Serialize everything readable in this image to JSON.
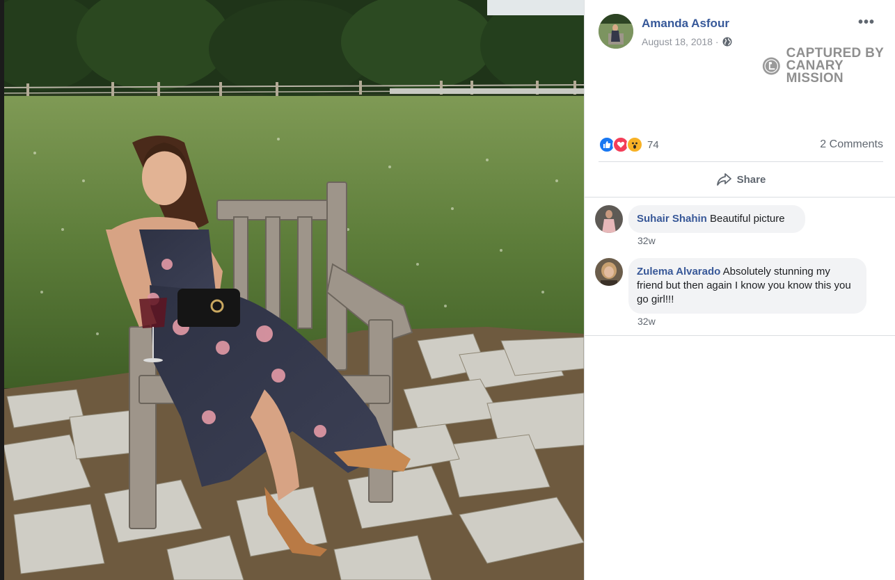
{
  "post": {
    "author": "Amanda Asfour",
    "date": "August 18, 2018 ·",
    "privacy_icon": "globe-icon",
    "more_icon": "ellipsis-icon",
    "watermark_line1": "CAPTURED BY",
    "watermark_line2": "CANARY MISSION",
    "reaction_count": "74",
    "reactions": [
      "like",
      "love",
      "wow"
    ],
    "comments_count": "2 Comments",
    "share_label": "Share"
  },
  "comments": [
    {
      "author": "Suhair Shahin",
      "text": " Beautiful picture",
      "time": "32w"
    },
    {
      "author": "Zulema Alvarado",
      "text": " Absolutely stunning my friend but then again I know you know this you go girl!!!",
      "time": "32w"
    }
  ],
  "colors": {
    "link": "#365899",
    "like": "#1877f2",
    "love": "#f33e58",
    "wow": "#f7b125",
    "watermark": "#8f8f8f"
  }
}
